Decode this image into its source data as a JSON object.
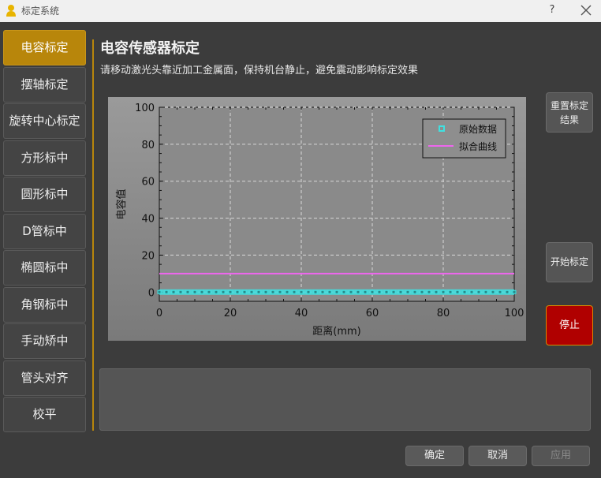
{
  "window": {
    "title": "标定系统",
    "help_label": "?"
  },
  "sidebar": {
    "items": [
      {
        "label": "电容标定",
        "active": true
      },
      {
        "label": "摆轴标定"
      },
      {
        "label": "旋转中心标定"
      },
      {
        "label": "方形标中"
      },
      {
        "label": "圆形标中"
      },
      {
        "label": "D管标中"
      },
      {
        "label": "椭圆标中"
      },
      {
        "label": "角钢标中"
      },
      {
        "label": "手动矫中"
      },
      {
        "label": "管头对齐"
      },
      {
        "label": "校平"
      }
    ]
  },
  "main": {
    "title": "电容传感器标定",
    "instruction": "请移动激光头靠近加工金属面，保持机台静止，避免震动影响标定效果"
  },
  "side_buttons": {
    "reset": "重置标定结果",
    "start": "开始标定",
    "stop": "停止"
  },
  "footer": {
    "ok": "确定",
    "cancel": "取消",
    "apply": "应用"
  },
  "colors": {
    "accent": "#b8860b",
    "stop": "#b00000",
    "raw_points": "#40e0e0",
    "fit_line": "#ee66ee"
  },
  "chart_data": {
    "type": "line",
    "xlabel": "距离(mm)",
    "ylabel": "电容值",
    "xlim": [
      0,
      100
    ],
    "ylim": [
      -5,
      100
    ],
    "xticks": [
      0,
      20,
      40,
      60,
      80,
      100
    ],
    "yticks": [
      0,
      20,
      40,
      60,
      80,
      100
    ],
    "grid": true,
    "legend_position": "top-right",
    "series": [
      {
        "name": "原始数据",
        "kind": "scatter",
        "color": "#40e0e0",
        "x": [
          0,
          2,
          4,
          6,
          8,
          10,
          12,
          14,
          16,
          18,
          20,
          22,
          24,
          26,
          28,
          30,
          32,
          34,
          36,
          38,
          40,
          42,
          44,
          46,
          48,
          50,
          52,
          54,
          56,
          58,
          60,
          62,
          64,
          66,
          68,
          70,
          72,
          74,
          76,
          78,
          80,
          82,
          84,
          86,
          88,
          90,
          92,
          94,
          96,
          98,
          100
        ],
        "y": [
          0,
          0,
          0,
          0,
          0,
          0,
          0,
          0,
          0,
          0,
          0,
          0,
          0,
          0,
          0,
          0,
          0,
          0,
          0,
          0,
          0,
          0,
          0,
          0,
          0,
          0,
          0,
          0,
          0,
          0,
          0,
          0,
          0,
          0,
          0,
          0,
          0,
          0,
          0,
          0,
          0,
          0,
          0,
          0,
          0,
          0,
          0,
          0,
          0,
          0,
          0
        ]
      },
      {
        "name": "拟合曲线",
        "kind": "line",
        "color": "#ee66ee",
        "x": [
          0,
          100
        ],
        "y": [
          10,
          10
        ]
      }
    ]
  }
}
